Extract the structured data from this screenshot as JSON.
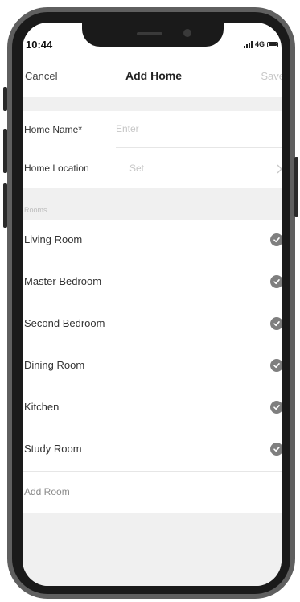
{
  "status_bar": {
    "time": "10:44",
    "network": "4G"
  },
  "nav": {
    "cancel_label": "Cancel",
    "title": "Add Home",
    "save_label": "Save"
  },
  "form": {
    "home_name_label": "Home Name*",
    "home_name_placeholder": "Enter",
    "home_location_label": "Home Location",
    "home_location_value": "Set"
  },
  "rooms": {
    "header": "Rooms",
    "items": [
      {
        "label": "Living Room",
        "checked": true
      },
      {
        "label": "Master Bedroom",
        "checked": true
      },
      {
        "label": "Second Bedroom",
        "checked": true
      },
      {
        "label": "Dining Room",
        "checked": true
      },
      {
        "label": "Kitchen",
        "checked": true
      },
      {
        "label": "Study Room",
        "checked": true
      }
    ],
    "add_label": "Add Room"
  },
  "colors": {
    "check": "#7f7f7f",
    "background_gray": "#f0f0f0"
  },
  "icons": {
    "check": "checkmark-circle-icon",
    "chevron": "chevron-right-icon",
    "signal": "signal-bars-icon",
    "battery": "battery-icon"
  }
}
